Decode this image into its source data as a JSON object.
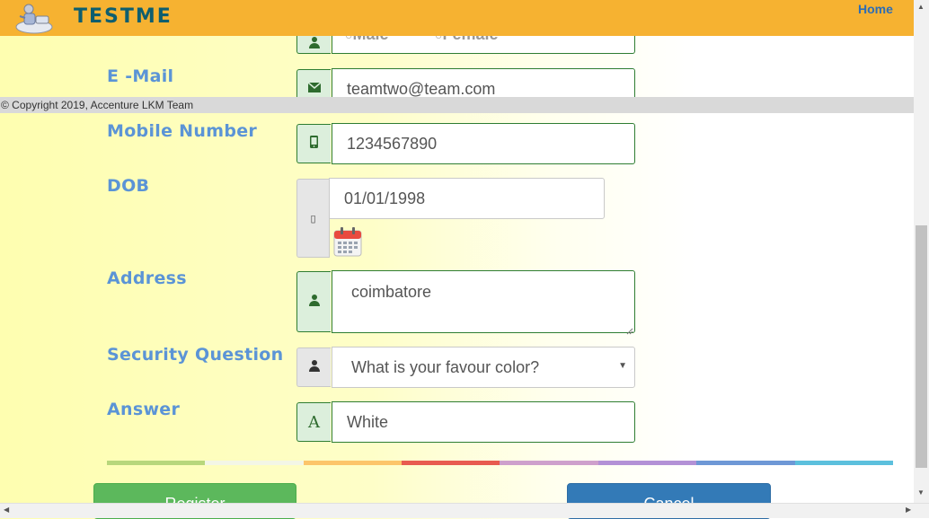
{
  "header": {
    "brand": "TESTME",
    "home_link": "Home"
  },
  "footer": {
    "copyright": "© Copyright 2019, Accenture LKM Team"
  },
  "form": {
    "gender": {
      "options": [
        "Male",
        "Female"
      ]
    },
    "email": {
      "label": "E -Mail",
      "value": "teamtwo@team.com"
    },
    "mobile": {
      "label": "Mobile Number",
      "value": "1234567890"
    },
    "dob": {
      "label": "DOB",
      "value": "01/01/1998"
    },
    "address": {
      "label": "Address",
      "value": "coimbatore"
    },
    "security_question": {
      "label": "Security Question",
      "selected": "What is your favour color?"
    },
    "answer": {
      "label": "Answer",
      "value": "White",
      "addon_glyph": "A"
    }
  },
  "buttons": {
    "register": "Register",
    "cancel": "Cancel"
  },
  "rainbow_colors": [
    "#b8d77c",
    "#f3f6e6",
    "#fcc56a",
    "#e85b50",
    "#cea0cc",
    "#b391d6",
    "#6e98d6",
    "#5cc0dd"
  ],
  "icons": {
    "email": "envelope-icon",
    "mobile": "mobile-icon",
    "dob": "calendar-icon",
    "address": "user-icon",
    "security": "user-icon",
    "logo": "logo-icon"
  }
}
